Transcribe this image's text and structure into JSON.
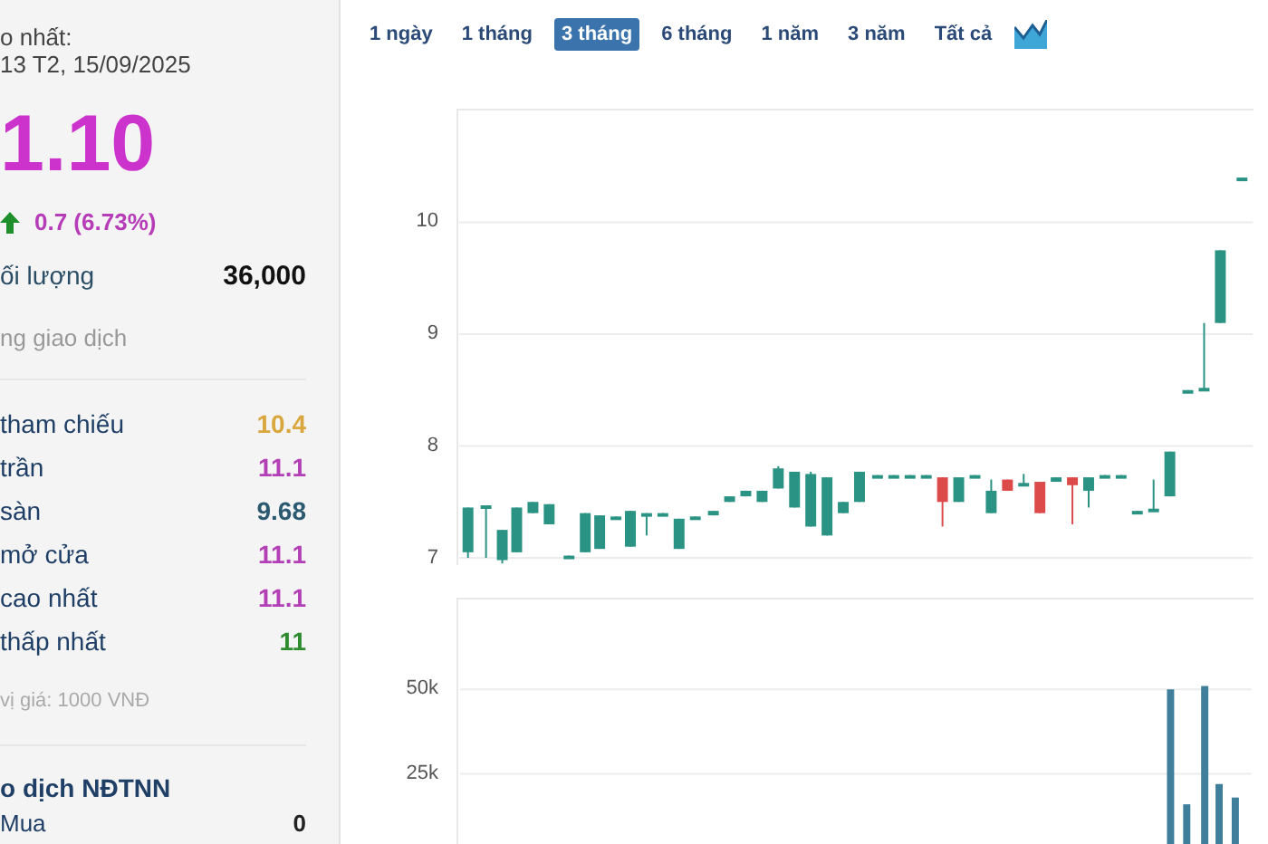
{
  "last_update": {
    "label": "o nhất:",
    "time": "13 T2, 15/09/2025"
  },
  "price": "1.10",
  "change": {
    "kind": "up",
    "text": "0.7 (6.73%)"
  },
  "volume": {
    "label": "ối lượng",
    "value": "36,000"
  },
  "volume_note": "ng giao dịch",
  "price_rows": [
    {
      "label": "tham chiếu",
      "value": "10.4",
      "color": "#d9a73e"
    },
    {
      "label": "trần",
      "value": "11.1",
      "color": "#b23fb5"
    },
    {
      "label": "sàn",
      "value": "9.68",
      "color": "#2b5a70"
    },
    {
      "label": "mở cửa",
      "value": "11.1",
      "color": "#b23fb5"
    },
    {
      "label": "cao nhất",
      "value": "11.1",
      "color": "#b23fb5"
    },
    {
      "label": "thấp nhất",
      "value": "11",
      "color": "#2e8b2e"
    }
  ],
  "unit_note": "vị giá: 1000 VNĐ",
  "foreign": {
    "title": "o dịch NĐTNN",
    "rows": [
      {
        "label": "Mua",
        "value": "0"
      }
    ]
  },
  "range_tabs": [
    {
      "label": "1 ngày",
      "selected": false
    },
    {
      "label": "1 tháng",
      "selected": false
    },
    {
      "label": "3 tháng",
      "selected": true
    },
    {
      "label": "6 tháng",
      "selected": false
    },
    {
      "label": "1 năm",
      "selected": false
    },
    {
      "label": "3 năm",
      "selected": false
    },
    {
      "label": "Tất cả",
      "selected": false
    }
  ],
  "price_axis": {
    "ticks": [
      "10",
      "9",
      "8",
      "7"
    ]
  },
  "volume_axis": {
    "ticks": [
      "50k",
      "25k"
    ]
  }
}
